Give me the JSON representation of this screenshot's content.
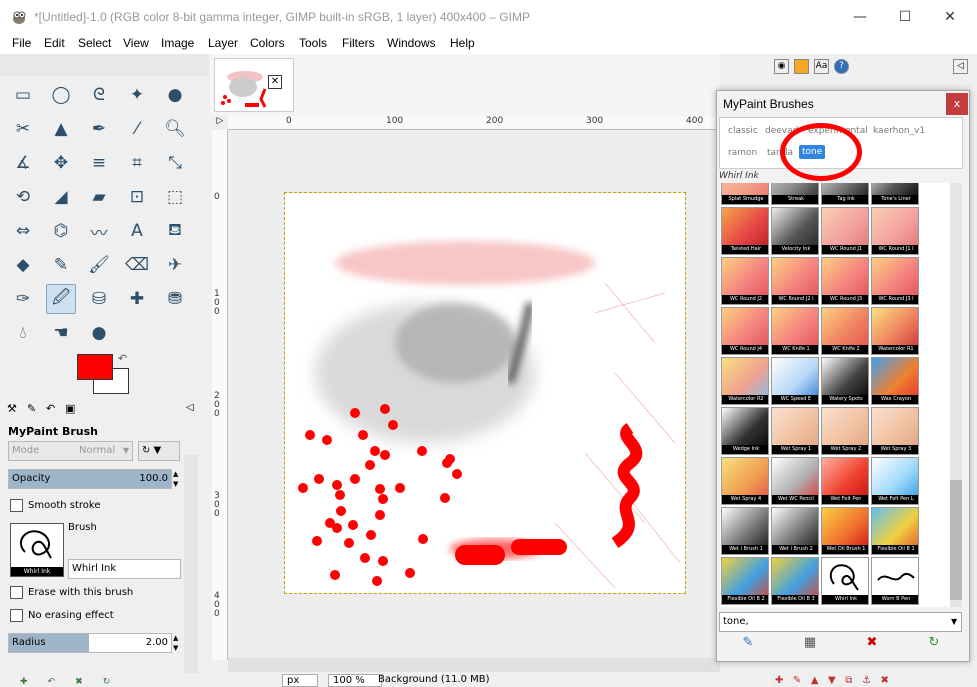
{
  "window": {
    "title": "*[Untitled]-1.0 (RGB color 8-bit gamma integer, GIMP built-in sRGB, 1 layer) 400x400 – GIMP",
    "minimize": "—",
    "maximize": "☐",
    "close": "✕"
  },
  "menu": [
    "File",
    "Edit",
    "Select",
    "View",
    "Image",
    "Layer",
    "Colors",
    "Tools",
    "Filters",
    "Windows",
    "Help"
  ],
  "tool_options": {
    "title": "MyPaint Brush",
    "mode_label": "Mode",
    "mode_value": "Normal",
    "opacity_label": "Opacity",
    "opacity_value": "100.0",
    "smooth_stroke": "Smooth stroke",
    "brush_label": "Brush",
    "brush_name": "Whirl Ink",
    "brush_preview_label": "Whirl Ink",
    "erase": "Erase with this brush",
    "no_erasing": "No erasing effect",
    "radius_label": "Radius",
    "radius_value": "2.00"
  },
  "ruler": {
    "h_ticks": [
      "0",
      "100",
      "200",
      "300",
      "400"
    ],
    "v_ticks": [
      "0",
      "100",
      "200",
      "300",
      "400"
    ],
    "corner": "▷"
  },
  "status": {
    "unit": "px",
    "zoom": "100 %",
    "layer": "Background (11.0 MB)"
  },
  "dialog": {
    "title": "MyPaint Brushes",
    "close": "x",
    "tags": [
      "classic",
      "deevad",
      "experimental",
      "kaerhon_v1",
      "ramon",
      "tanda",
      "tone"
    ],
    "selected_tag": "tone",
    "current_brush": "Whirl Ink",
    "tag_entry": "tone,",
    "brushes": [
      "Splat Smudge",
      "Streak",
      "Tag Ink",
      "Tone's Liner",
      "Twisted Hair",
      "Velocity Ink",
      "WC Round J1",
      "WC Round J1 l",
      "WC Round J2",
      "WC Round J2 l",
      "WC Round J3",
      "WC Round J3 l",
      "WC Round J4",
      "WC Knife 1",
      "WC Knife 2",
      "Watercolor R1",
      "Watercolor R2",
      "WC Speed E",
      "Watery Spots",
      "Wax Crayon",
      "Wedge Ink",
      "Wet Spray 1",
      "Wet Spray 2",
      "Wet Spray 3",
      "Wet Spray 4",
      "Wet WC Pencil",
      "Wet Felt Pen",
      "Wet Felt Pen L",
      "Wet I Brush 1",
      "Wet I Brush 2",
      "Wet Oil Brush 1",
      "Flexible Oil B 1",
      "Flexible Oil B 2",
      "Flexible Oil B 3",
      "Whirl Ink",
      "Worn B Pen"
    ]
  },
  "colors": {
    "foreground": "#ff0000",
    "background": "#ffffff",
    "annotation": "#ff0000"
  }
}
